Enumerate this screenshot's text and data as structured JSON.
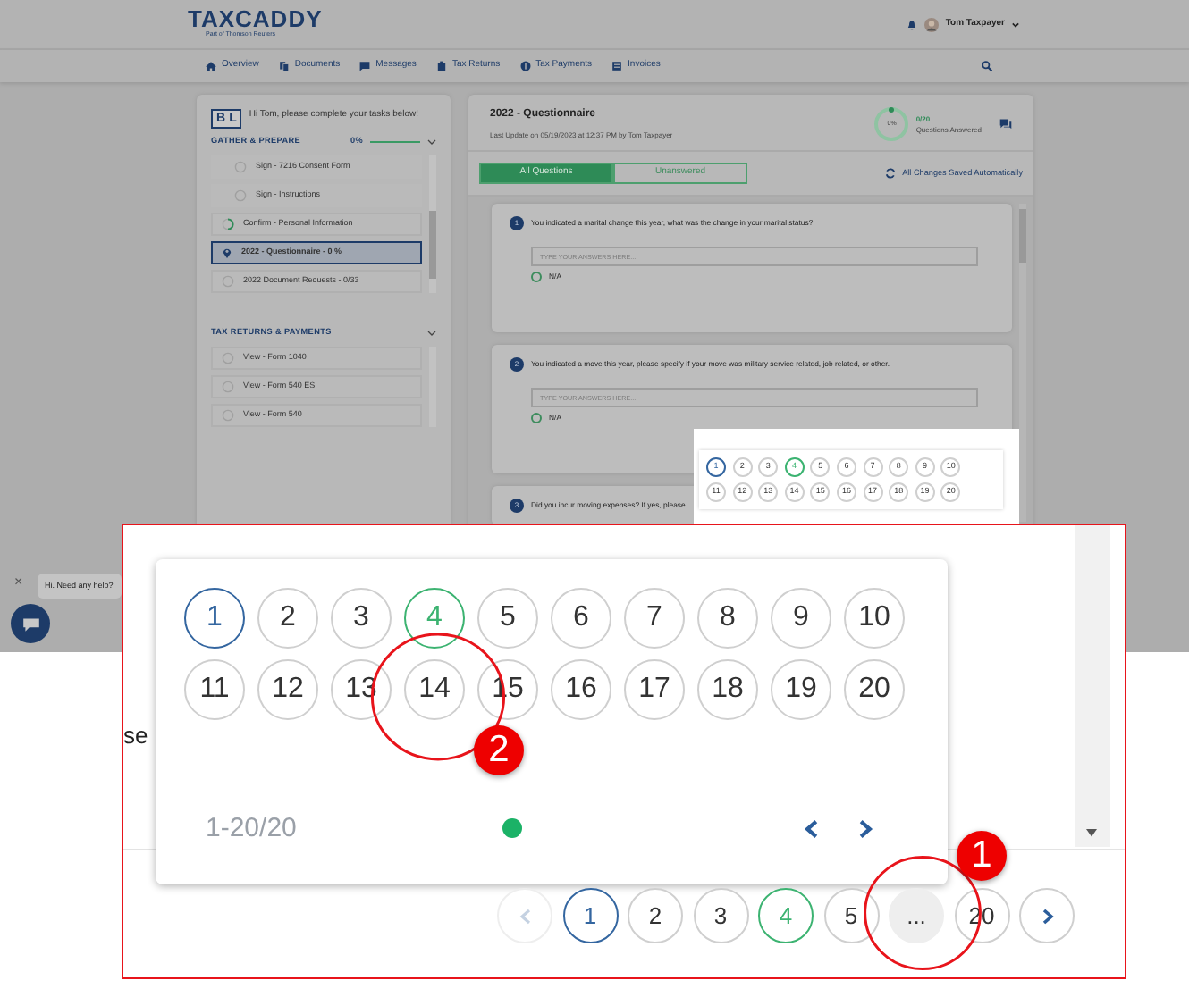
{
  "header": {
    "logo": "TAXCADDY",
    "tagline": "Part of Thomson Reuters",
    "user": "Tom Taxpayer"
  },
  "nav": [
    {
      "label": "Overview"
    },
    {
      "label": "Documents"
    },
    {
      "label": "Messages"
    },
    {
      "label": "Tax Returns"
    },
    {
      "label": "Tax Payments"
    },
    {
      "label": "Invoices"
    }
  ],
  "sidebar": {
    "logo": [
      "B",
      "L"
    ],
    "greeting": "Hi Tom, please complete your tasks below!",
    "sections": [
      {
        "title": "GATHER & PREPARE",
        "progress": "0%",
        "expanded": true,
        "tasks": [
          {
            "label": "Sign - 7216 Consent Form",
            "kind": "subtask",
            "selected": false
          },
          {
            "label": "Sign - Instructions",
            "kind": "subtask",
            "selected": false
          },
          {
            "label": "Confirm - Personal Information",
            "kind": "partial",
            "selected": false
          },
          {
            "label": "2022 - Questionnaire - 0 %",
            "kind": "current",
            "selected": true
          },
          {
            "label": "2022 Document Requests - 0/33",
            "kind": "todo",
            "selected": false
          }
        ]
      },
      {
        "title": "TAX RETURNS & PAYMENTS",
        "expanded": true,
        "tasks": [
          {
            "label": "View - Form 1040",
            "kind": "todo",
            "selected": false
          },
          {
            "label": "View - Form 540 ES",
            "kind": "todo",
            "selected": false
          },
          {
            "label": "View - Form 540",
            "kind": "todo",
            "selected": false
          }
        ]
      }
    ]
  },
  "main": {
    "title": "2022 - Questionnaire",
    "updated": "Last Update on 05/19/2023 at 12:37 PM by Tom Taxpayer",
    "ring_label": "0%",
    "answered": "0/20",
    "answered_label": "Questions Answered",
    "tabs": [
      {
        "label": "All Questions",
        "selected": true
      },
      {
        "label": "Unanswered",
        "selected": false
      }
    ],
    "save_status": "All Changes Saved Automatically",
    "questions": [
      {
        "number": "1",
        "text": "You indicated a marital change this year, what was the change in your marital status?",
        "placeholder": "TYPE YOUR ANSWERS HERE...",
        "option": "N/A",
        "checked": false
      },
      {
        "number": "2",
        "text": "You indicated a move this year, please specify if your move was military service related, job related, or other.",
        "placeholder": "TYPE YOUR ANSWERS HERE...",
        "option": "N/A",
        "checked": false
      },
      {
        "number": "3",
        "text": "Did you incur moving expenses? If yes, please ."
      }
    ]
  },
  "chat": {
    "close": "×",
    "message": "Hi. Need any help?"
  },
  "preview_grid": [
    {
      "label": "1",
      "selected": true,
      "answered": false
    },
    {
      "label": "2",
      "selected": false,
      "answered": false
    },
    {
      "label": "3",
      "selected": false,
      "answered": false
    },
    {
      "label": "4",
      "selected": false,
      "answered": true
    },
    {
      "label": "5",
      "selected": false,
      "answered": false
    },
    {
      "label": "6",
      "selected": false,
      "answered": false
    },
    {
      "label": "7",
      "selected": false,
      "answered": false
    },
    {
      "label": "8",
      "selected": false,
      "answered": false
    },
    {
      "label": "9",
      "selected": false,
      "answered": false
    },
    {
      "label": "10",
      "selected": false,
      "answered": false
    },
    {
      "label": "11",
      "selected": false,
      "answered": false
    },
    {
      "label": "12",
      "selected": false,
      "answered": false
    },
    {
      "label": "13",
      "selected": false,
      "answered": false
    },
    {
      "label": "14",
      "selected": false,
      "answered": false
    },
    {
      "label": "15",
      "selected": false,
      "answered": false
    },
    {
      "label": "16",
      "selected": false,
      "answered": false
    },
    {
      "label": "17",
      "selected": false,
      "answered": false
    },
    {
      "label": "18",
      "selected": false,
      "answered": false
    },
    {
      "label": "19",
      "selected": false,
      "answered": false
    },
    {
      "label": "20",
      "selected": false,
      "answered": false
    }
  ],
  "callout": {
    "fragment": "se",
    "grid": [
      {
        "label": "1",
        "selected": true,
        "answered": false
      },
      {
        "label": "2",
        "selected": false,
        "answered": false
      },
      {
        "label": "3",
        "selected": false,
        "answered": false
      },
      {
        "label": "4",
        "selected": false,
        "answered": true
      },
      {
        "label": "5",
        "selected": false,
        "answered": false
      },
      {
        "label": "6",
        "selected": false,
        "answered": false
      },
      {
        "label": "7",
        "selected": false,
        "answered": false
      },
      {
        "label": "8",
        "selected": false,
        "answered": false
      },
      {
        "label": "9",
        "selected": false,
        "answered": false
      },
      {
        "label": "10",
        "selected": false,
        "answered": false
      },
      {
        "label": "11",
        "selected": false,
        "answered": false
      },
      {
        "label": "12",
        "selected": false,
        "answered": false
      },
      {
        "label": "13",
        "selected": false,
        "answered": false
      },
      {
        "label": "14",
        "selected": false,
        "answered": false
      },
      {
        "label": "15",
        "selected": false,
        "answered": false
      },
      {
        "label": "16",
        "selected": false,
        "answered": false
      },
      {
        "label": "17",
        "selected": false,
        "answered": false
      },
      {
        "label": "18",
        "selected": false,
        "answered": false
      },
      {
        "label": "19",
        "selected": false,
        "answered": false
      },
      {
        "label": "20",
        "selected": false,
        "answered": false
      }
    ],
    "range": "1-20/20",
    "pagination": {
      "prev_disabled": true,
      "pages": [
        {
          "label": "1",
          "kind": "page",
          "selected": true,
          "answered": false
        },
        {
          "label": "2",
          "kind": "page",
          "selected": false,
          "answered": false
        },
        {
          "label": "3",
          "kind": "page",
          "selected": false,
          "answered": false
        },
        {
          "label": "4",
          "kind": "page",
          "selected": false,
          "answered": true
        },
        {
          "label": "5",
          "kind": "page",
          "selected": false,
          "answered": false
        },
        {
          "label": "...",
          "kind": "ellipsis",
          "selected": false,
          "answered": false
        },
        {
          "label": "20",
          "kind": "page",
          "selected": false,
          "answered": false
        }
      ]
    },
    "annotations": [
      {
        "number": "1"
      },
      {
        "number": "2"
      }
    ]
  }
}
